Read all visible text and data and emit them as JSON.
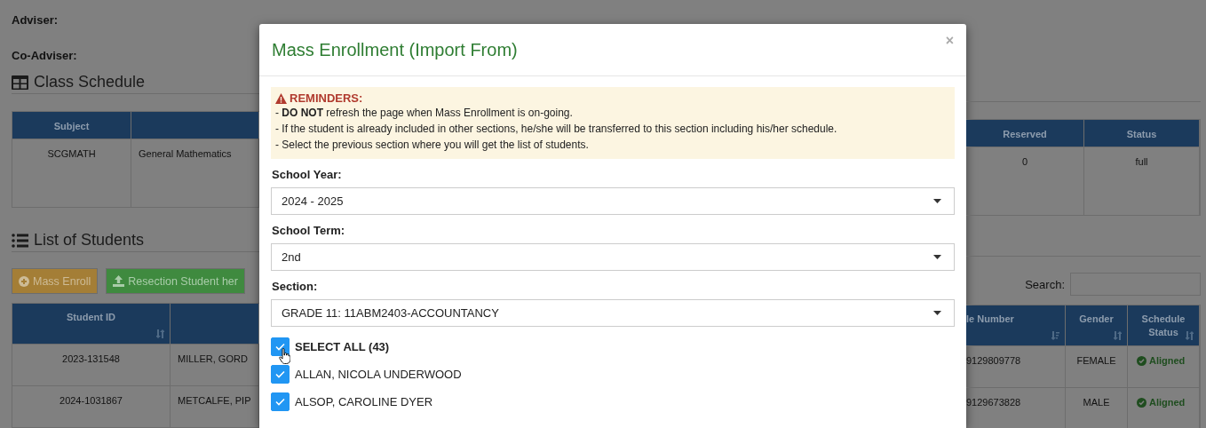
{
  "page": {
    "adviser_label": "Adviser:",
    "co_adviser_label": "Co-Adviser:",
    "class_schedule": {
      "title": "Class Schedule",
      "left": {
        "headers": [
          "Subject"
        ],
        "rows": [
          [
            "SCGMATH",
            "General Mathematics"
          ]
        ]
      },
      "right": {
        "headers": [
          "Reserved",
          "Status"
        ],
        "rows": [
          [
            "0",
            "full"
          ]
        ]
      }
    },
    "students": {
      "title": "List of Students",
      "buttons": [
        {
          "label": "Mass Enroll",
          "kind": "warning"
        },
        {
          "label": "Resection Student her",
          "kind": "success"
        }
      ],
      "search_label": "Search:",
      "left": {
        "headers": [
          {
            "label": "Student ID",
            "sorted": false
          }
        ],
        "rows": [
          [
            "2023-131548",
            "MILLER, GORD"
          ],
          [
            "2024-1031867",
            "METCALFE, PIP"
          ]
        ]
      },
      "right": {
        "headers": [
          {
            "label": "le Number",
            "sorted": true
          },
          {
            "label": "Gender",
            "sorted": false
          },
          {
            "label": "Schedule Status",
            "sorted": false
          }
        ],
        "rows": [
          {
            "cells": [
              "9129809778",
              "FEMALE"
            ],
            "status": "Aligned"
          },
          {
            "cells": [
              "9129673828",
              "MALE"
            ],
            "status": "Aligned"
          }
        ]
      }
    }
  },
  "modal": {
    "title": "Mass Enrollment (Import From)",
    "close": "×",
    "reminders": {
      "title": "REMINDERS:",
      "lines": [
        "- **DO NOT** refresh the page when Mass Enrollment is on-going.",
        "- If the student is already included in other sections, he/she will be transferred to this section including his/her schedule.",
        "- Select the previous section where you will get the list of students."
      ]
    },
    "fields": [
      {
        "label": "School Year:",
        "value": "2024 - 2025"
      },
      {
        "label": "School Term:",
        "value": "2nd"
      },
      {
        "label": "Section:",
        "value": "GRADE 11: 11ABM2403-ACCOUNTANCY"
      }
    ],
    "select_all": {
      "label": "SELECT ALL (43)",
      "checked": true
    },
    "students": [
      {
        "name": "ALLAN, NICOLA UNDERWOOD",
        "checked": true
      },
      {
        "name": "ALSOP, CAROLINE DYER",
        "checked": true
      }
    ]
  }
}
